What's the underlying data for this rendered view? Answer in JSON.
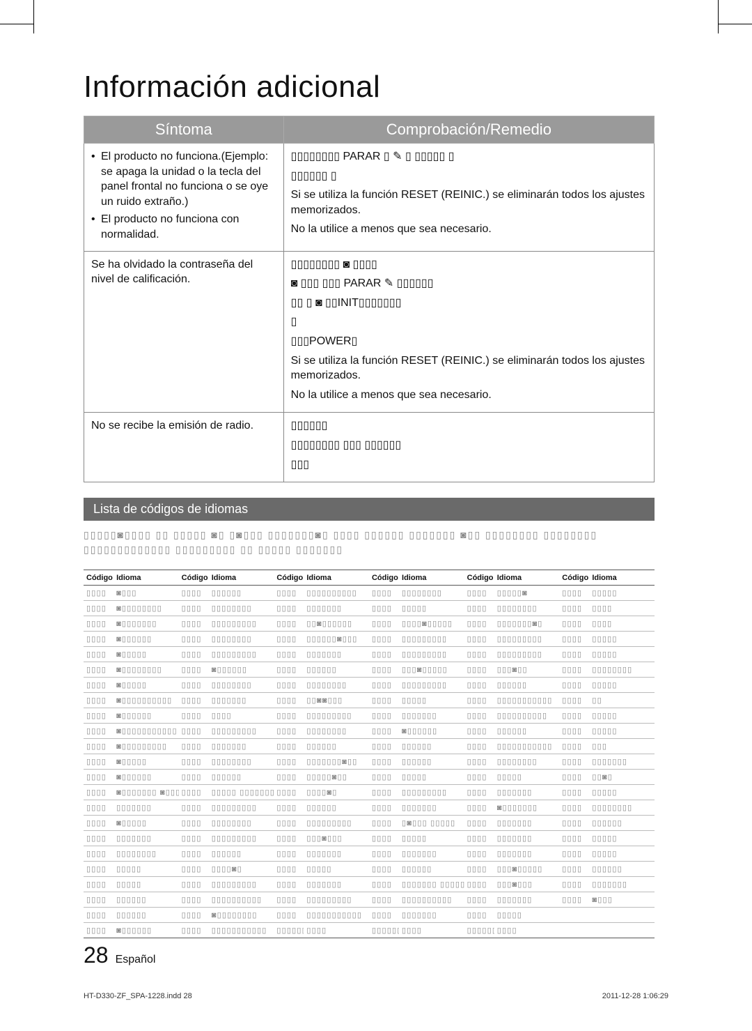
{
  "header": {
    "title": "Información adicional"
  },
  "table": {
    "head": {
      "symptom": "Síntoma",
      "remedy": "Comprobación/Remedio"
    },
    "rows": [
      {
        "symptom_items": [
          "El producto no funciona.(Ejemplo: se apaga la unidad o la tecla del panel frontal no funciona o se oye un ruido extraño.)",
          "El producto no funciona con normalidad."
        ],
        "remedy_lines": [
          "▯▯▯▯▯▯▯▯ PARAR ▯ ✎             ▯ ▯▯▯▯▯ ▯",
          "▯▯▯▯▯▯ ▯",
          "Si se utiliza la función RESET (REINIC.) se eliminarán todos los ajustes memorizados.",
          "No la utilice a menos que sea necesario."
        ]
      },
      {
        "symptom_text": "Se ha olvidado la contraseña del nivel de calificación.",
        "remedy_lines": [
          "▯▯▯▯▯▯▯▯ ◙ ▯▯▯▯",
          "◙ ▯▯▯   ▯▯▯ PARAR                    ✎ ▯▯▯▯▯▯",
          "▯▯ ▯  ◙ ▯▯INIT▯▯▯▯▯▯▯",
          "▯",
          "▯▯▯POWER▯",
          "Si se utiliza la función RESET (REINIC.) se eliminarán todos los ajustes memorizados.",
          "No la utilice a menos que sea necesario."
        ]
      },
      {
        "symptom_text": "No se recibe la emisión de radio.",
        "remedy_lines": [
          "▯▯▯▯▯▯",
          "▯▯▯▯▯▯▯▯ ▯▯▯ ▯▯▯▯▯▯",
          "▯▯▯"
        ]
      }
    ]
  },
  "banner": {
    "label": "Lista de códigos de idiomas"
  },
  "intro": "▯▯▯▯▯◙▯▯▯▯ ▯▯ ▯▯▯▯▯ ◙▯ ▯◙▯▯▯ ▯▯▯▯▯▯▯◙▯ ▯▯▯▯ ▯▯▯▯▯▯ ▯▯▯▯▯▯▯ ◙▯▯ ▯▯▯▯▯▯▯▯ ▯▯▯▯▯▯▯▯ ▯▯▯▯▯▯▯▯▯▯▯▯▯ ▯▯▯▯▯▯▯▯▯ ▯▯ ▯▯▯▯▯ ▯▯▯▯▯▯▯",
  "lang": {
    "head": {
      "code": "Código",
      "idiom": "Idioma"
    },
    "rows": [
      [
        [
          "▯▯▯▯",
          "◙▯▯▯"
        ],
        [
          "▯▯▯▯",
          "▯▯▯▯▯▯"
        ],
        [
          "▯▯▯▯",
          "▯▯▯▯▯▯▯▯▯▯"
        ],
        [
          "▯▯▯▯",
          "▯▯▯▯▯▯▯▯"
        ],
        [
          "▯▯▯▯",
          "▯▯▯▯▯◙"
        ],
        [
          "▯▯▯▯",
          "▯▯▯▯▯"
        ]
      ],
      [
        [
          "▯▯▯▯",
          "◙▯▯▯▯▯▯▯▯"
        ],
        [
          "▯▯▯▯",
          "▯▯▯▯▯▯▯▯"
        ],
        [
          "▯▯▯▯",
          "▯▯▯▯▯▯▯"
        ],
        [
          "▯▯▯▯",
          "▯▯▯▯▯"
        ],
        [
          "▯▯▯▯",
          "▯▯▯▯▯▯▯▯"
        ],
        [
          "▯▯▯▯",
          "▯▯▯▯"
        ]
      ],
      [
        [
          "▯▯▯▯",
          "◙▯▯▯▯▯▯▯"
        ],
        [
          "▯▯▯▯",
          "▯▯▯▯▯▯▯▯▯"
        ],
        [
          "▯▯▯▯",
          "▯▯◙▯▯▯▯▯▯"
        ],
        [
          "▯▯▯▯",
          "▯▯▯▯◙▯▯▯▯▯"
        ],
        [
          "▯▯▯▯",
          "▯▯▯▯▯▯▯◙▯"
        ],
        [
          "▯▯▯▯",
          "▯▯▯▯"
        ]
      ],
      [
        [
          "▯▯▯▯",
          "◙▯▯▯▯▯▯"
        ],
        [
          "▯▯▯▯",
          "▯▯▯▯▯▯▯▯"
        ],
        [
          "▯▯▯▯",
          "▯▯▯▯▯▯◙▯▯▯"
        ],
        [
          "▯▯▯▯",
          "▯▯▯▯▯▯▯▯▯"
        ],
        [
          "▯▯▯▯",
          "▯▯▯▯▯▯▯▯▯"
        ],
        [
          "▯▯▯▯",
          "▯▯▯▯▯"
        ]
      ],
      [
        [
          "▯▯▯▯",
          "◙▯▯▯▯▯"
        ],
        [
          "▯▯▯▯",
          "▯▯▯▯▯▯▯▯▯"
        ],
        [
          "▯▯▯▯",
          "▯▯▯▯▯▯▯"
        ],
        [
          "▯▯▯▯",
          "▯▯▯▯▯▯▯▯▯"
        ],
        [
          "▯▯▯▯",
          "▯▯▯▯▯▯▯▯▯"
        ],
        [
          "▯▯▯▯",
          "▯▯▯▯▯"
        ]
      ],
      [
        [
          "▯▯▯▯",
          "◙▯▯▯▯▯▯▯▯"
        ],
        [
          "▯▯▯▯",
          "◙▯▯▯▯▯▯"
        ],
        [
          "▯▯▯▯",
          "▯▯▯▯▯▯"
        ],
        [
          "▯▯▯▯",
          "▯▯▯◙▯▯▯▯▯"
        ],
        [
          "▯▯▯▯",
          "▯▯▯◙▯▯"
        ],
        [
          "▯▯▯▯",
          "▯▯▯▯▯▯▯▯"
        ]
      ],
      [
        [
          "▯▯▯▯",
          "◙▯▯▯▯▯"
        ],
        [
          "▯▯▯▯",
          "▯▯▯▯▯▯▯▯"
        ],
        [
          "▯▯▯▯",
          "▯▯▯▯▯▯▯▯"
        ],
        [
          "▯▯▯▯",
          "▯▯▯▯▯▯▯▯▯"
        ],
        [
          "▯▯▯▯",
          "▯▯▯▯▯▯"
        ],
        [
          "▯▯▯▯",
          "▯▯▯▯▯"
        ]
      ],
      [
        [
          "▯▯▯▯",
          "◙▯▯▯▯▯▯▯▯▯▯"
        ],
        [
          "▯▯▯▯",
          "▯▯▯▯▯▯▯"
        ],
        [
          "▯▯▯▯",
          "▯▯◙◙▯▯▯"
        ],
        [
          "▯▯▯▯",
          "▯▯▯▯▯"
        ],
        [
          "▯▯▯▯",
          "▯▯▯▯▯▯▯▯▯▯▯"
        ],
        [
          "▯▯▯▯",
          "▯▯"
        ]
      ],
      [
        [
          "▯▯▯▯",
          "◙▯▯▯▯▯▯"
        ],
        [
          "▯▯▯▯",
          "▯▯▯▯"
        ],
        [
          "▯▯▯▯",
          "▯▯▯▯▯▯▯▯▯"
        ],
        [
          "▯▯▯▯",
          "▯▯▯▯▯▯▯"
        ],
        [
          "▯▯▯▯",
          "▯▯▯▯▯▯▯▯▯▯"
        ],
        [
          "▯▯▯▯",
          "▯▯▯▯▯"
        ]
      ],
      [
        [
          "▯▯▯▯",
          "◙▯▯▯▯▯▯▯▯▯▯▯"
        ],
        [
          "▯▯▯▯",
          "▯▯▯▯▯▯▯▯▯"
        ],
        [
          "▯▯▯▯",
          "▯▯▯▯▯▯▯▯"
        ],
        [
          "▯▯▯▯",
          "◙▯▯▯▯▯▯"
        ],
        [
          "▯▯▯▯",
          "▯▯▯▯▯▯"
        ],
        [
          "▯▯▯▯",
          "▯▯▯▯▯"
        ]
      ],
      [
        [
          "▯▯▯▯",
          "◙▯▯▯▯▯▯▯▯▯"
        ],
        [
          "▯▯▯▯",
          "▯▯▯▯▯▯▯"
        ],
        [
          "▯▯▯▯",
          "▯▯▯▯▯▯"
        ],
        [
          "▯▯▯▯",
          "▯▯▯▯▯▯"
        ],
        [
          "▯▯▯▯",
          "▯▯▯▯▯▯▯▯▯▯▯"
        ],
        [
          "▯▯▯▯",
          "▯▯▯"
        ]
      ],
      [
        [
          "▯▯▯▯",
          "◙▯▯▯▯▯"
        ],
        [
          "▯▯▯▯",
          "▯▯▯▯▯▯▯▯"
        ],
        [
          "▯▯▯▯",
          "▯▯▯▯▯▯▯◙▯▯"
        ],
        [
          "▯▯▯▯",
          "▯▯▯▯▯▯"
        ],
        [
          "▯▯▯▯",
          "▯▯▯▯▯▯▯▯"
        ],
        [
          "▯▯▯▯",
          "▯▯▯▯▯▯▯"
        ]
      ],
      [
        [
          "▯▯▯▯",
          "◙▯▯▯▯▯▯"
        ],
        [
          "▯▯▯▯",
          "▯▯▯▯▯▯"
        ],
        [
          "▯▯▯▯",
          "▯▯▯▯▯◙▯▯"
        ],
        [
          "▯▯▯▯",
          "▯▯▯▯▯"
        ],
        [
          "▯▯▯▯",
          "▯▯▯▯▯"
        ],
        [
          "▯▯▯▯",
          "▯▯◙▯"
        ]
      ],
      [
        [
          "▯▯▯▯",
          "◙▯▯▯▯▯▯▯ ◙▯▯▯▯▯"
        ],
        [
          "▯▯▯▯",
          "▯▯▯▯▯ ▯▯▯▯▯▯▯"
        ],
        [
          "▯▯▯▯",
          "▯▯▯▯◙▯"
        ],
        [
          "▯▯▯▯",
          "▯▯▯▯▯▯▯▯▯"
        ],
        [
          "▯▯▯▯",
          "▯▯▯▯▯▯▯"
        ],
        [
          "▯▯▯▯",
          "▯▯▯▯▯"
        ]
      ],
      [
        [
          "▯▯▯▯",
          "▯▯▯▯▯▯▯"
        ],
        [
          "▯▯▯▯",
          "▯▯▯▯▯▯▯▯▯"
        ],
        [
          "▯▯▯▯",
          "▯▯▯▯▯▯"
        ],
        [
          "▯▯▯▯",
          "▯▯▯▯▯▯▯"
        ],
        [
          "▯▯▯▯",
          "◙▯▯▯▯▯▯▯"
        ],
        [
          "▯▯▯▯",
          "▯▯▯▯▯▯▯▯"
        ]
      ],
      [
        [
          "▯▯▯▯",
          "◙▯▯▯▯▯"
        ],
        [
          "▯▯▯▯",
          "▯▯▯▯▯▯▯▯"
        ],
        [
          "▯▯▯▯",
          "▯▯▯▯▯▯▯▯▯"
        ],
        [
          "▯▯▯▯",
          "▯◙▯▯▯ ▯▯▯▯▯"
        ],
        [
          "▯▯▯▯",
          "▯▯▯▯▯▯▯"
        ],
        [
          "▯▯▯▯",
          "▯▯▯▯▯▯"
        ]
      ],
      [
        [
          "▯▯▯▯",
          "▯▯▯▯▯▯▯"
        ],
        [
          "▯▯▯▯",
          "▯▯▯▯▯▯▯▯▯"
        ],
        [
          "▯▯▯▯",
          "▯▯▯◙▯▯▯"
        ],
        [
          "▯▯▯▯",
          "▯▯▯▯▯"
        ],
        [
          "▯▯▯▯",
          "▯▯▯▯▯▯▯"
        ],
        [
          "▯▯▯▯",
          "▯▯▯▯▯"
        ]
      ],
      [
        [
          "▯▯▯▯",
          "▯▯▯▯▯▯▯▯"
        ],
        [
          "▯▯▯▯",
          "▯▯▯▯▯▯"
        ],
        [
          "▯▯▯▯",
          "▯▯▯▯▯▯▯"
        ],
        [
          "▯▯▯▯",
          "▯▯▯▯▯▯▯"
        ],
        [
          "▯▯▯▯",
          "▯▯▯▯▯▯▯"
        ],
        [
          "▯▯▯▯",
          "▯▯▯▯▯"
        ]
      ],
      [
        [
          "▯▯▯▯",
          "▯▯▯▯▯"
        ],
        [
          "▯▯▯▯",
          "▯▯▯▯◙▯"
        ],
        [
          "▯▯▯▯",
          "▯▯▯▯▯"
        ],
        [
          "▯▯▯▯",
          "▯▯▯▯▯▯"
        ],
        [
          "▯▯▯▯",
          "▯▯▯◙▯▯▯▯▯"
        ],
        [
          "▯▯▯▯",
          "▯▯▯▯▯▯"
        ]
      ],
      [
        [
          "▯▯▯▯",
          "▯▯▯▯▯"
        ],
        [
          "▯▯▯▯",
          "▯▯▯▯▯▯▯▯▯"
        ],
        [
          "▯▯▯▯",
          "▯▯▯▯▯▯▯"
        ],
        [
          "▯▯▯▯",
          "▯▯▯▯▯▯▯ ▯▯▯▯▯▯"
        ],
        [
          "▯▯▯▯",
          "▯▯▯◙▯▯▯"
        ],
        [
          "▯▯▯▯",
          "▯▯▯▯▯▯▯"
        ]
      ],
      [
        [
          "▯▯▯▯",
          "▯▯▯▯▯▯"
        ],
        [
          "▯▯▯▯",
          "▯▯▯▯▯▯▯▯▯▯"
        ],
        [
          "▯▯▯▯",
          "▯▯▯▯▯▯▯▯▯"
        ],
        [
          "▯▯▯▯",
          "▯▯▯▯▯▯▯▯▯▯"
        ],
        [
          "▯▯▯▯",
          "▯▯▯▯▯▯▯"
        ],
        [
          "▯▯▯▯",
          "◙▯▯▯"
        ]
      ],
      [
        [
          "▯▯▯▯",
          "▯▯▯▯▯▯"
        ],
        [
          "▯▯▯▯",
          "◙▯▯▯▯▯▯▯▯"
        ],
        [
          "▯▯▯▯",
          "▯▯▯▯▯▯▯▯▯▯▯"
        ],
        [
          "▯▯▯▯",
          "▯▯▯▯▯▯▯"
        ],
        [
          "▯▯▯▯",
          "▯▯▯▯▯"
        ],
        [
          "",
          ""
        ]
      ],
      [
        [
          "▯▯▯▯",
          "◙▯▯▯▯▯▯"
        ],
        [
          "▯▯▯▯",
          "▯▯▯▯▯▯▯▯▯▯▯"
        ],
        [
          "▯▯▯▯▯▯▯▯ ▯▯▯▯▯▯▯",
          "▯▯▯▯"
        ],
        [
          "▯▯▯▯▯▯▯ ▯▯▯▯▯▯▯",
          "▯▯▯▯"
        ],
        [
          "▯▯▯▯▯▯",
          "▯▯▯▯"
        ],
        [
          "",
          ""
        ]
      ]
    ]
  },
  "footer": {
    "page": "28",
    "lang": "Español"
  },
  "print": {
    "left": "HT-D330-ZF_SPA-1228.indd   28",
    "right": "2011-12-28    1:06:29"
  }
}
